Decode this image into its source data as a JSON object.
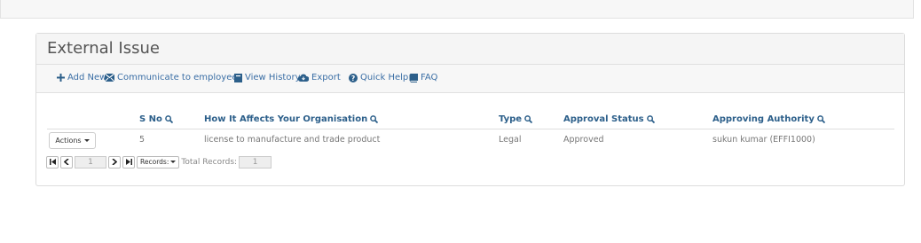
{
  "panel": {
    "title": "External Issue"
  },
  "toolbar": {
    "add_new": "Add New",
    "communicate": "Communicate to employees",
    "view_history": "View History",
    "export": "Export",
    "quick_help": "Quick Help",
    "faq": "FAQ"
  },
  "table": {
    "columns": [
      "S No",
      "How It Affects Your Organisation",
      "Type",
      "Approval Status",
      "Approving Authority"
    ],
    "rows": [
      {
        "actions": "Actions",
        "s_no": "5",
        "affects": "license to manufacture and trade product",
        "type": "Legal",
        "approval_status": "Approved",
        "approving_authority": "sukun kumar (EFFI1000)"
      }
    ]
  },
  "pager": {
    "page": "1",
    "records_label": "Records:",
    "total_label": "Total Records:",
    "total": "1"
  },
  "colors": {
    "link": "#3a6ea5",
    "header": "#2c5f8a",
    "text": "#777777"
  },
  "icons": [
    "plus-icon",
    "envelope-icon",
    "book-icon",
    "cloud-download-icon",
    "question-circle-icon",
    "faq-book-icon",
    "search-icon",
    "caret-down-icon"
  ]
}
